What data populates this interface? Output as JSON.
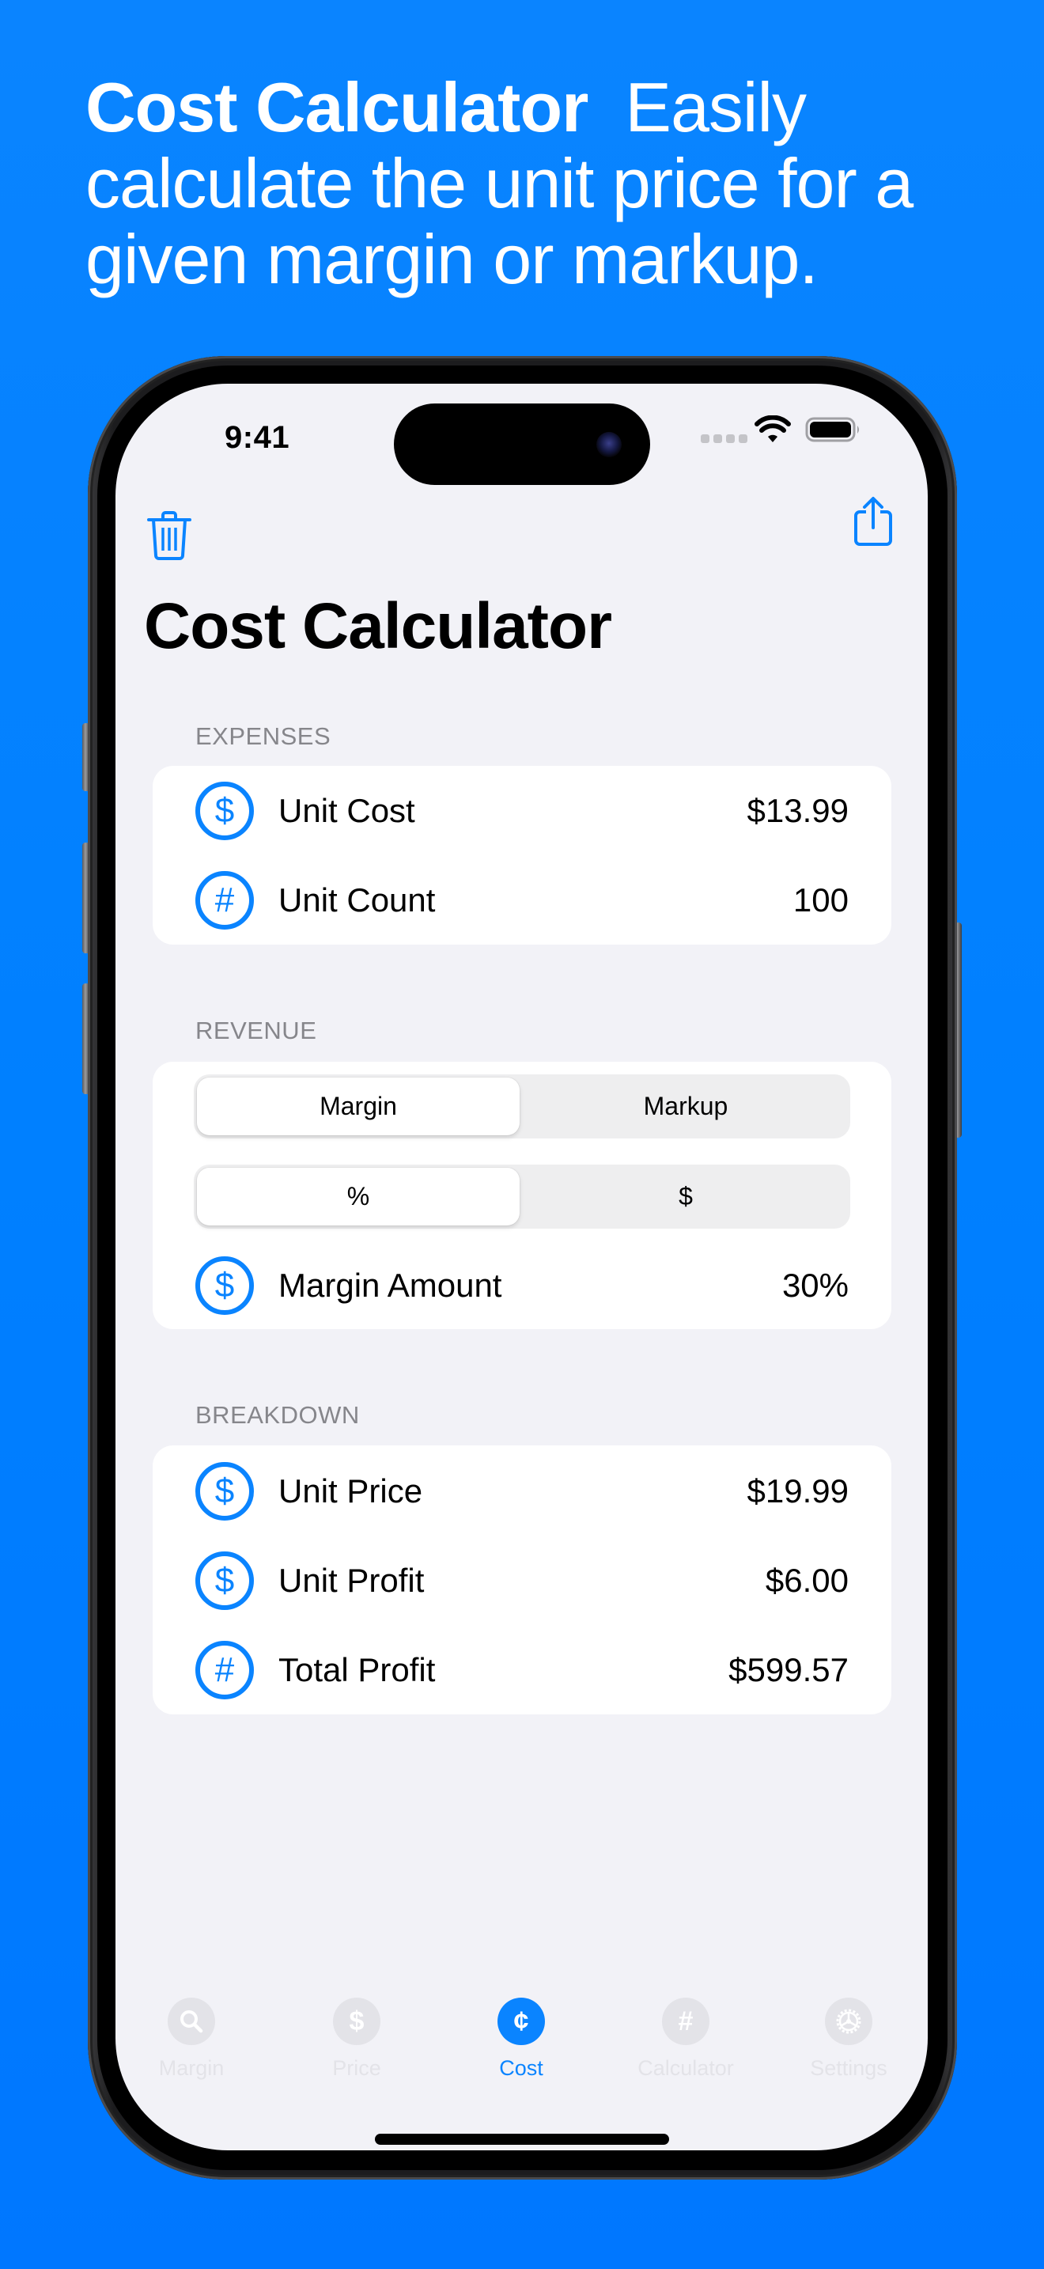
{
  "headline": {
    "bold": "Cost Calculator",
    "rest": "Easily calculate the unit price for a given margin or markup."
  },
  "status_bar": {
    "time": "9:41",
    "icons": [
      "cellular-signal-icon",
      "wifi-icon",
      "battery-icon"
    ]
  },
  "nav_bar": {
    "left_icon": "trash-icon",
    "right_icon": "share-icon"
  },
  "page_title": "Cost Calculator",
  "expenses": {
    "header": "Expenses",
    "rows": [
      {
        "icon": "dollarsign-circle-icon",
        "glyph": "$",
        "label": "Unit Cost",
        "value": "$13.99"
      },
      {
        "icon": "number-circle-icon",
        "glyph": "#",
        "label": "Unit Count",
        "value": "100"
      }
    ]
  },
  "revenue": {
    "header": "Revenue",
    "mode_picker": {
      "options": [
        "Margin",
        "Markup"
      ],
      "selected": "Margin"
    },
    "unit_picker": {
      "options": [
        "%",
        "$"
      ],
      "selected": "%"
    },
    "rows": [
      {
        "icon": "dollarsign-circle-icon",
        "glyph": "$",
        "label": "Margin Amount",
        "value": "30%"
      }
    ]
  },
  "breakdown": {
    "header": "Breakdown",
    "rows": [
      {
        "icon": "dollarsign-circle-icon",
        "glyph": "$",
        "label": "Unit Price",
        "value": "$19.99"
      },
      {
        "icon": "dollarsign-circle-icon",
        "glyph": "$",
        "label": "Unit Profit",
        "value": "$6.00"
      },
      {
        "icon": "number-circle-icon",
        "glyph": "#",
        "label": "Total Profit",
        "value": "$599.57"
      }
    ]
  },
  "tab_bar": {
    "items": [
      {
        "label": "Margin",
        "icon": "magnifyingglass-icon",
        "glyph": "",
        "active": false
      },
      {
        "label": "Price",
        "icon": "dollarsign-icon",
        "glyph": "$",
        "active": false
      },
      {
        "label": "Cost",
        "icon": "centsign-icon",
        "glyph": "¢",
        "active": true
      },
      {
        "label": "Calculator",
        "icon": "number-icon",
        "glyph": "#",
        "active": false
      },
      {
        "label": "Settings",
        "icon": "gear-icon",
        "glyph": "",
        "active": false
      }
    ]
  },
  "colors": {
    "accent": "#0A84FF",
    "background": "#0A84FF",
    "screen_background": "#F2F2F7",
    "card": "#FFFFFF",
    "section_header": "#86868B",
    "tab_inactive": "#E3E3E8"
  }
}
